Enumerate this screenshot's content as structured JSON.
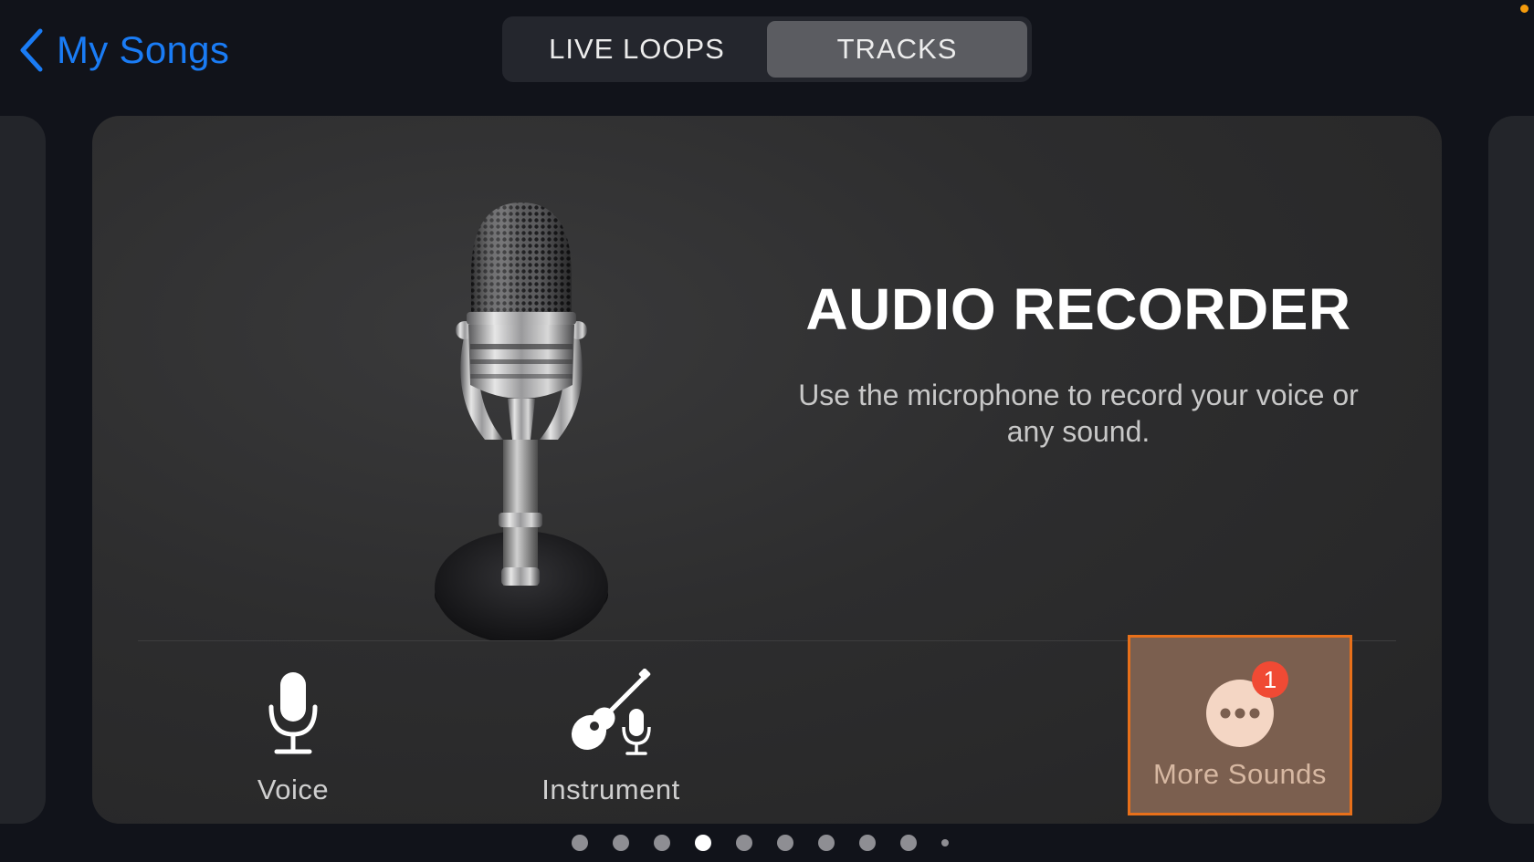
{
  "nav": {
    "back_label": "My Songs",
    "tabs": [
      {
        "label": "LIVE LOOPS",
        "active": false
      },
      {
        "label": "TRACKS",
        "active": true
      }
    ]
  },
  "card": {
    "title": "AUDIO RECORDER",
    "description_line1": "Use the microphone to record your voice or",
    "description_line2": "any sound.",
    "illustration": "vintage-microphone",
    "options": [
      {
        "label": "Voice",
        "icon": "microphone-icon"
      },
      {
        "label": "Instrument",
        "icon": "guitar-microphone-icon"
      },
      {
        "label": "More Sounds",
        "icon": "more-icon",
        "badge": "1",
        "highlighted": true
      }
    ]
  },
  "pager": {
    "total": 10,
    "active_index": 3
  },
  "colors": {
    "accent": "#1a7cf5",
    "highlight_border": "#e8701a",
    "badge": "#f04a34",
    "status_dot": "#f59b0c"
  }
}
